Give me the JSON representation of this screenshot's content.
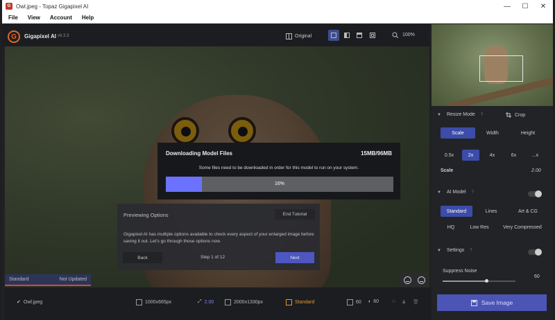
{
  "window": {
    "title": "Owl.jpeg - Topaz Gigapixel AI",
    "controls": {
      "minimize": "—",
      "maximize": "☐",
      "close": "✕"
    }
  },
  "menu": [
    "File",
    "View",
    "Account",
    "Help"
  ],
  "app": {
    "name": "Gigapixel AI",
    "version": "v6.3.3",
    "logo_letter": "G"
  },
  "toolbar": {
    "original_label": "Original",
    "zoom": "100%",
    "active_view": 0
  },
  "download_dialog": {
    "title": "Downloading Model Files",
    "size": "15MB/96MB",
    "description": "Some files need to be downloaded in order for this model to run on your system.",
    "progress_fraction": 0.16,
    "progress_label": "16%",
    "progress_color": "#6b72ff"
  },
  "tutorial": {
    "title": "Previewing Options",
    "end_label": "End Tutorial",
    "body": "Gigapixel AI has multiple options available to check every aspect of your enlarged image before saving it out. Let's go through those options now.",
    "back_label": "Back",
    "step_label": "Step 1 of 12",
    "next_label": "Next"
  },
  "canvas_status": {
    "model": "Standard",
    "state": "Not Updated"
  },
  "right_panel": {
    "resize_mode": {
      "label": "Resize Mode",
      "crop_label": "Crop",
      "tabs": [
        "Scale",
        "Width",
        "Height"
      ],
      "active": 0
    },
    "scales": [
      "0.5x",
      "2x",
      "4x",
      "6x",
      "...x"
    ],
    "active_scale": 1,
    "scale_label": "Scale",
    "scale_value": "2.00",
    "ai_model": {
      "label": "AI Model",
      "row1": [
        "Standard",
        "Lines",
        "Art & CG"
      ],
      "row2": [
        "HQ",
        "Low Res",
        "Very Compressed"
      ],
      "active": 0
    },
    "settings": {
      "label": "Settings",
      "suppress_label": "Suppress Noise",
      "suppress_value": "60",
      "suppress_fraction": 0.6
    },
    "save_label": "Save Image"
  },
  "bottom_bar": {
    "filename": "Owl.jpeg",
    "source_size": "1000x665px",
    "scale": "2.00",
    "output_size": "2000x1330px",
    "model": "Standard",
    "noise": "60",
    "blur": "60"
  },
  "colors": {
    "accent": "#3c4ca8",
    "brand": "#e06a24",
    "warning": "#e0433b"
  }
}
